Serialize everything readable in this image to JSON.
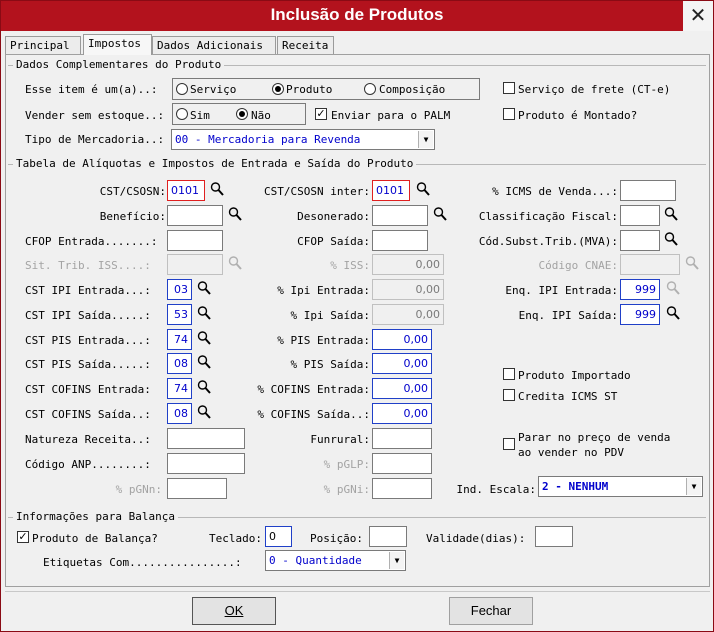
{
  "window": {
    "title": "Inclusão de Produtos",
    "close": "✕"
  },
  "tabs": [
    "Principal",
    "Impostos",
    "Dados Adicionais",
    "Receita"
  ],
  "dados": {
    "group": "Dados Complementares do Produto",
    "item_label": "Esse item é um(a)..:",
    "item_opts": [
      "Serviço",
      "Produto",
      "Composição"
    ],
    "frete": "Serviço de frete (CT-e)",
    "vender_label": "Vender sem estoque..:",
    "vender_opts": [
      "Sim",
      "Não"
    ],
    "palm": "Enviar para o PALM",
    "montado": "Produto é Montado?",
    "tipo_label": "Tipo de Mercadoria..:",
    "tipo_value": "00 - Mercadoria para Revenda"
  },
  "tabela": {
    "group": "Tabela de Alíquotas e Impostos de Entrada e Saída do Produto",
    "cst_csosn": "CST/CSOSN:",
    "cst_csosn_v": "0101",
    "cst_inter": "CST/CSOSN inter:",
    "cst_inter_v": "0101",
    "icms_venda": "% ICMS de Venda...:",
    "beneficio": "Benefício:",
    "desonerado": "Desonerado:",
    "class_fiscal": "Classificação Fiscal:",
    "cfop_ent": "CFOP Entrada.......:",
    "cfop_sai": "CFOP Saída:",
    "cod_subst": "Cód.Subst.Trib.(MVA):",
    "sit_iss": "Sit. Trib. ISS....:",
    "pct_iss": "% ISS:",
    "pct_iss_v": "0,00",
    "cnae": "Código CNAE:",
    "ipi_ent": "CST IPI Entrada...:",
    "ipi_ent_v": "03",
    "pipi_ent": "% Ipi Entrada:",
    "pipi_ent_v": "0,00",
    "enq_ent": "Enq. IPI Entrada:",
    "enq_ent_v": "999",
    "ipi_sai": "CST IPI Saída.....:",
    "ipi_sai_v": "53",
    "pipi_sai": "% Ipi Saída:",
    "pipi_sai_v": "0,00",
    "enq_sai": "Enq. IPI Saída:",
    "enq_sai_v": "999",
    "pis_ent": "CST PIS Entrada...:",
    "pis_ent_v": "74",
    "ppis_ent": "% PIS Entrada:",
    "ppis_ent_v": "0,00",
    "pis_sai": "CST PIS Saída.....:",
    "pis_sai_v": "08",
    "ppis_sai": "% PIS Saída:",
    "ppis_sai_v": "0,00",
    "importado": "Produto Importado",
    "cof_ent": "CST COFINS Entrada:",
    "cof_ent_v": "74",
    "pcof_ent": "% COFINS Entrada:",
    "pcof_ent_v": "0,00",
    "credita": "Credita ICMS ST",
    "cof_sai": "CST COFINS Saída..:",
    "cof_sai_v": "08",
    "pcof_sai": "% COFINS Saída..:",
    "pcof_sai_v": "0,00",
    "natureza": "Natureza Receita..:",
    "funrural": "Funrural:",
    "parar1": "Parar no preço de venda",
    "parar2": "ao vender no PDV",
    "anp": "Código ANP........:",
    "pglp": "% pGLP:",
    "pgnn": "% pGNn:",
    "pgni": "% pGNi:",
    "ind_escala": "Ind. Escala:",
    "ind_escala_v": "2 - NENHUM"
  },
  "balanca": {
    "group": "Informações para Balança",
    "produto": "Produto de Balança?",
    "teclado": "Teclado:",
    "teclado_v": "0",
    "posicao": "Posição:",
    "validade": "Validade(dias):",
    "etiquetas": "Etiquetas Com................:",
    "etiquetas_v": "0 - Quantidade"
  },
  "buttons": {
    "ok": "OK",
    "fechar": "Fechar"
  }
}
